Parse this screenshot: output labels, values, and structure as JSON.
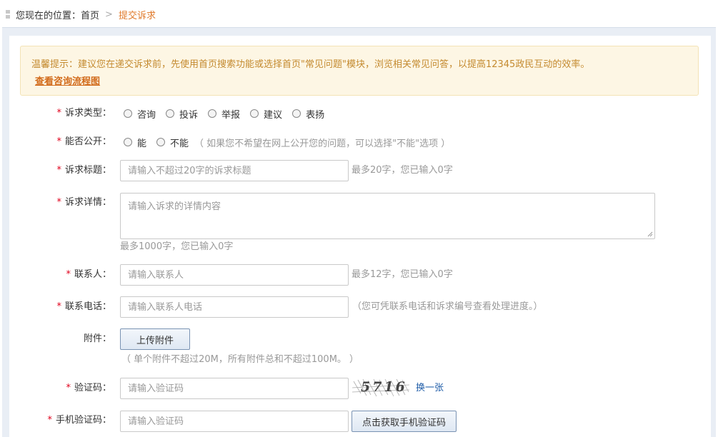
{
  "breadcrumb": {
    "prefix": "您现在的位置：",
    "home": "首页",
    "separator": ">",
    "current": "提交诉求"
  },
  "notice": {
    "text": "温馨提示：建议您在递交诉求前，先使用首页搜索功能或选择首页\"常见问题\"模块，浏览相关常见问答，以提高12345政民互动的效率。",
    "link": "查看咨询流程图"
  },
  "form": {
    "required_mark": "*",
    "type": {
      "label": "诉求类型：",
      "options": [
        "咨询",
        "投诉",
        "举报",
        "建议",
        "表扬"
      ]
    },
    "public": {
      "label": "能否公开：",
      "options": [
        "能",
        "不能"
      ],
      "hint": "（ 如果您不希望在网上公开您的问题，可以选择\"不能\"选项 ）"
    },
    "title": {
      "label": "诉求标题：",
      "placeholder": "请输入不超过20字的诉求标题",
      "hint": "最多20字，您已输入0字"
    },
    "detail": {
      "label": "诉求详情：",
      "placeholder": "请输入诉求的详情内容",
      "hint": "最多1000字，您已输入0字"
    },
    "contact": {
      "label": "联系人：",
      "placeholder": "请输入联系人",
      "hint": "最多12字，您已输入0字"
    },
    "phone": {
      "label": "联系电话：",
      "placeholder": "请输入联系人电话",
      "hint": "（您可凭联系电话和诉求编号查看处理进度。）"
    },
    "attachment": {
      "label": "附件：",
      "button": "上传附件",
      "hint": "（ 单个附件不超过20M，所有附件总和不超过100M。 ）"
    },
    "captcha": {
      "label": "验证码：",
      "placeholder": "请输入验证码",
      "image_text": "5716",
      "refresh": "换一张"
    },
    "sms": {
      "label": "手机验证码：",
      "placeholder": "请输入验证码",
      "button": "点击获取手机验证码"
    }
  }
}
